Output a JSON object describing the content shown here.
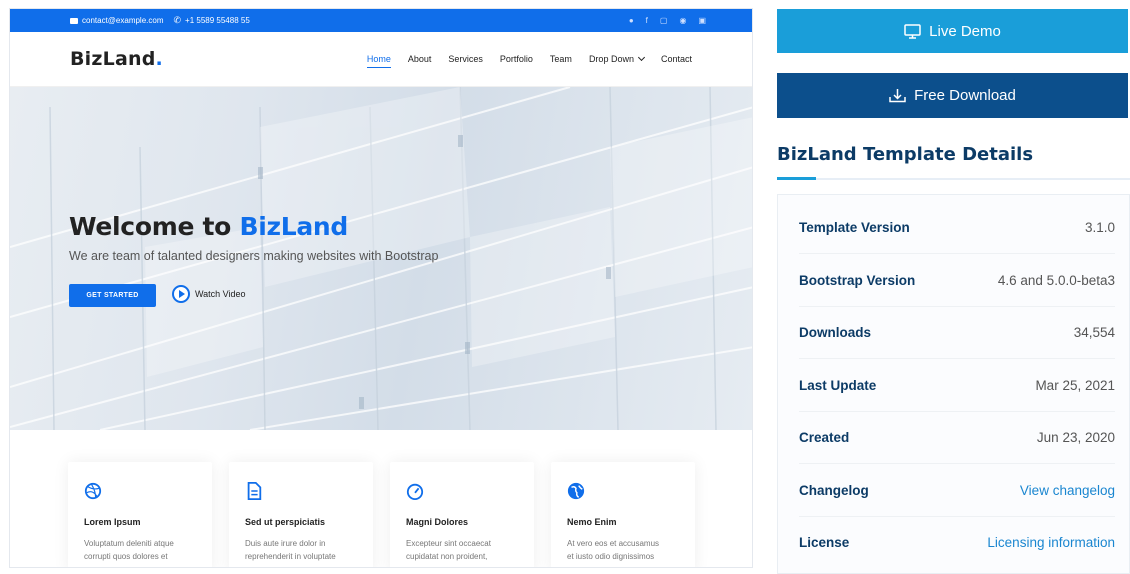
{
  "site": {
    "topbar": {
      "email": "contact@example.com",
      "phone": "+1 5589 55488 55",
      "social_icons": [
        "twitter-icon",
        "facebook-icon",
        "instagram-icon",
        "skype-icon",
        "linkedin-icon"
      ]
    },
    "logo_text": "BizLand",
    "logo_dot": ".",
    "nav": [
      "Home",
      "About",
      "Services",
      "Portfolio",
      "Team",
      "Drop Down",
      "Contact"
    ],
    "nav_active": "Home",
    "hero": {
      "title_prefix": "Welcome to ",
      "title_brand": "BizLand",
      "subtitle": "We are team of talanted designers making websites with Bootstrap",
      "cta_label": "GET STARTED",
      "watch_label": "Watch Video"
    },
    "cards": [
      {
        "icon": "dribbble-icon",
        "title": "Lorem Ipsum",
        "desc_line1": "Voluptatum deleniti atque",
        "desc_line2": "corrupti quos dolores et"
      },
      {
        "icon": "file-icon",
        "title": "Sed ut perspiciatis",
        "desc_line1": "Duis aute irure dolor in",
        "desc_line2": "reprehenderit in voluptate"
      },
      {
        "icon": "tachometer-icon",
        "title": "Magni Dolores",
        "desc_line1": "Excepteur sint occaecat",
        "desc_line2": "cupidatat non proident,"
      },
      {
        "icon": "world-icon",
        "title": "Nemo Enim",
        "desc_line1": "At vero eos et accusamus",
        "desc_line2": "et iusto odio dignissimos"
      }
    ]
  },
  "sidebar": {
    "live_demo_label": "Live Demo",
    "free_download_label": "Free Download",
    "details_title": "BizLand Template Details",
    "details": [
      {
        "key": "Template Version",
        "value": "3.1.0",
        "link": false
      },
      {
        "key": "Bootstrap Version",
        "value": "4.6 and 5.0.0-beta3",
        "link": false
      },
      {
        "key": "Downloads",
        "value": "34,554",
        "link": false
      },
      {
        "key": "Last Update",
        "value": "Mar 25, 2021",
        "link": false
      },
      {
        "key": "Created",
        "value": "Jun 23, 2020",
        "link": false
      },
      {
        "key": "Changelog",
        "value": "View changelog",
        "link": true
      },
      {
        "key": "License",
        "value": "Licensing information",
        "link": true
      }
    ]
  },
  "colors": {
    "brand_blue": "#106eea",
    "live_demo_bg": "#1a9ed9",
    "download_bg": "#0c4f8c",
    "details_heading": "#0c3b66",
    "link": "#1a86d0"
  }
}
